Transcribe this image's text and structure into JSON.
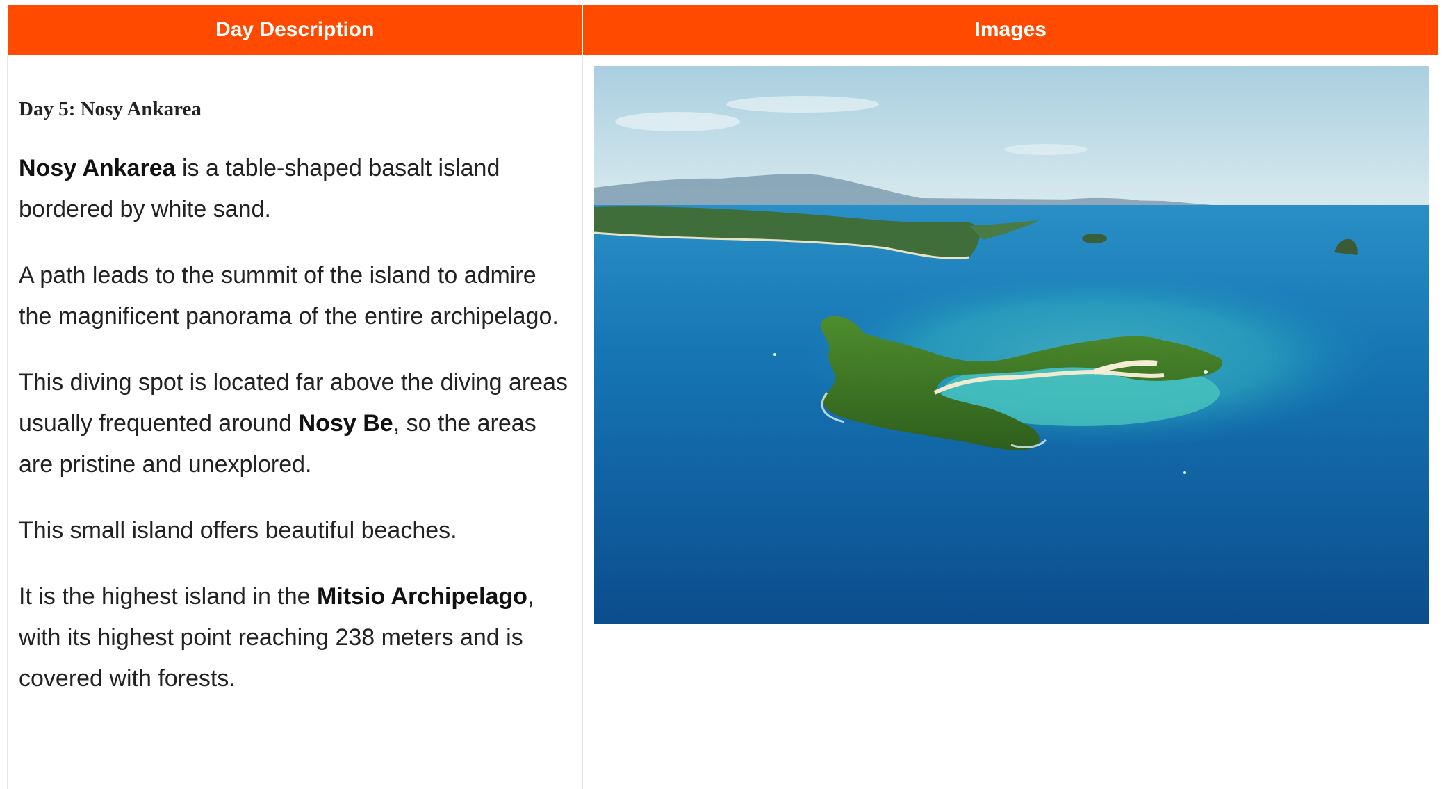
{
  "table": {
    "headers": [
      "Day Description",
      "Images"
    ]
  },
  "day": {
    "title": "Day 5: Nosy Ankarea",
    "p1": {
      "bold": "Nosy Ankarea",
      "rest": " is a table-shaped basalt island bordered by white sand."
    },
    "p2": "A path leads to the summit of the island to admire the magnificent panorama of the entire archipelago.",
    "p3": {
      "before": "This diving spot is located far above the diving areas usually frequented around ",
      "bold": "Nosy Be",
      "after": ", so the areas are pristine and unexplored."
    },
    "p4": "This small island offers beautiful beaches.",
    "p5": {
      "before": "It is the highest island in the ",
      "bold": "Mitsio Archipelago",
      "after": ", with its highest point reaching 238 meters and is covered with forests."
    }
  },
  "colors": {
    "header_bg": "#ff4a00",
    "header_text": "#ffffff",
    "text": "#222222"
  }
}
